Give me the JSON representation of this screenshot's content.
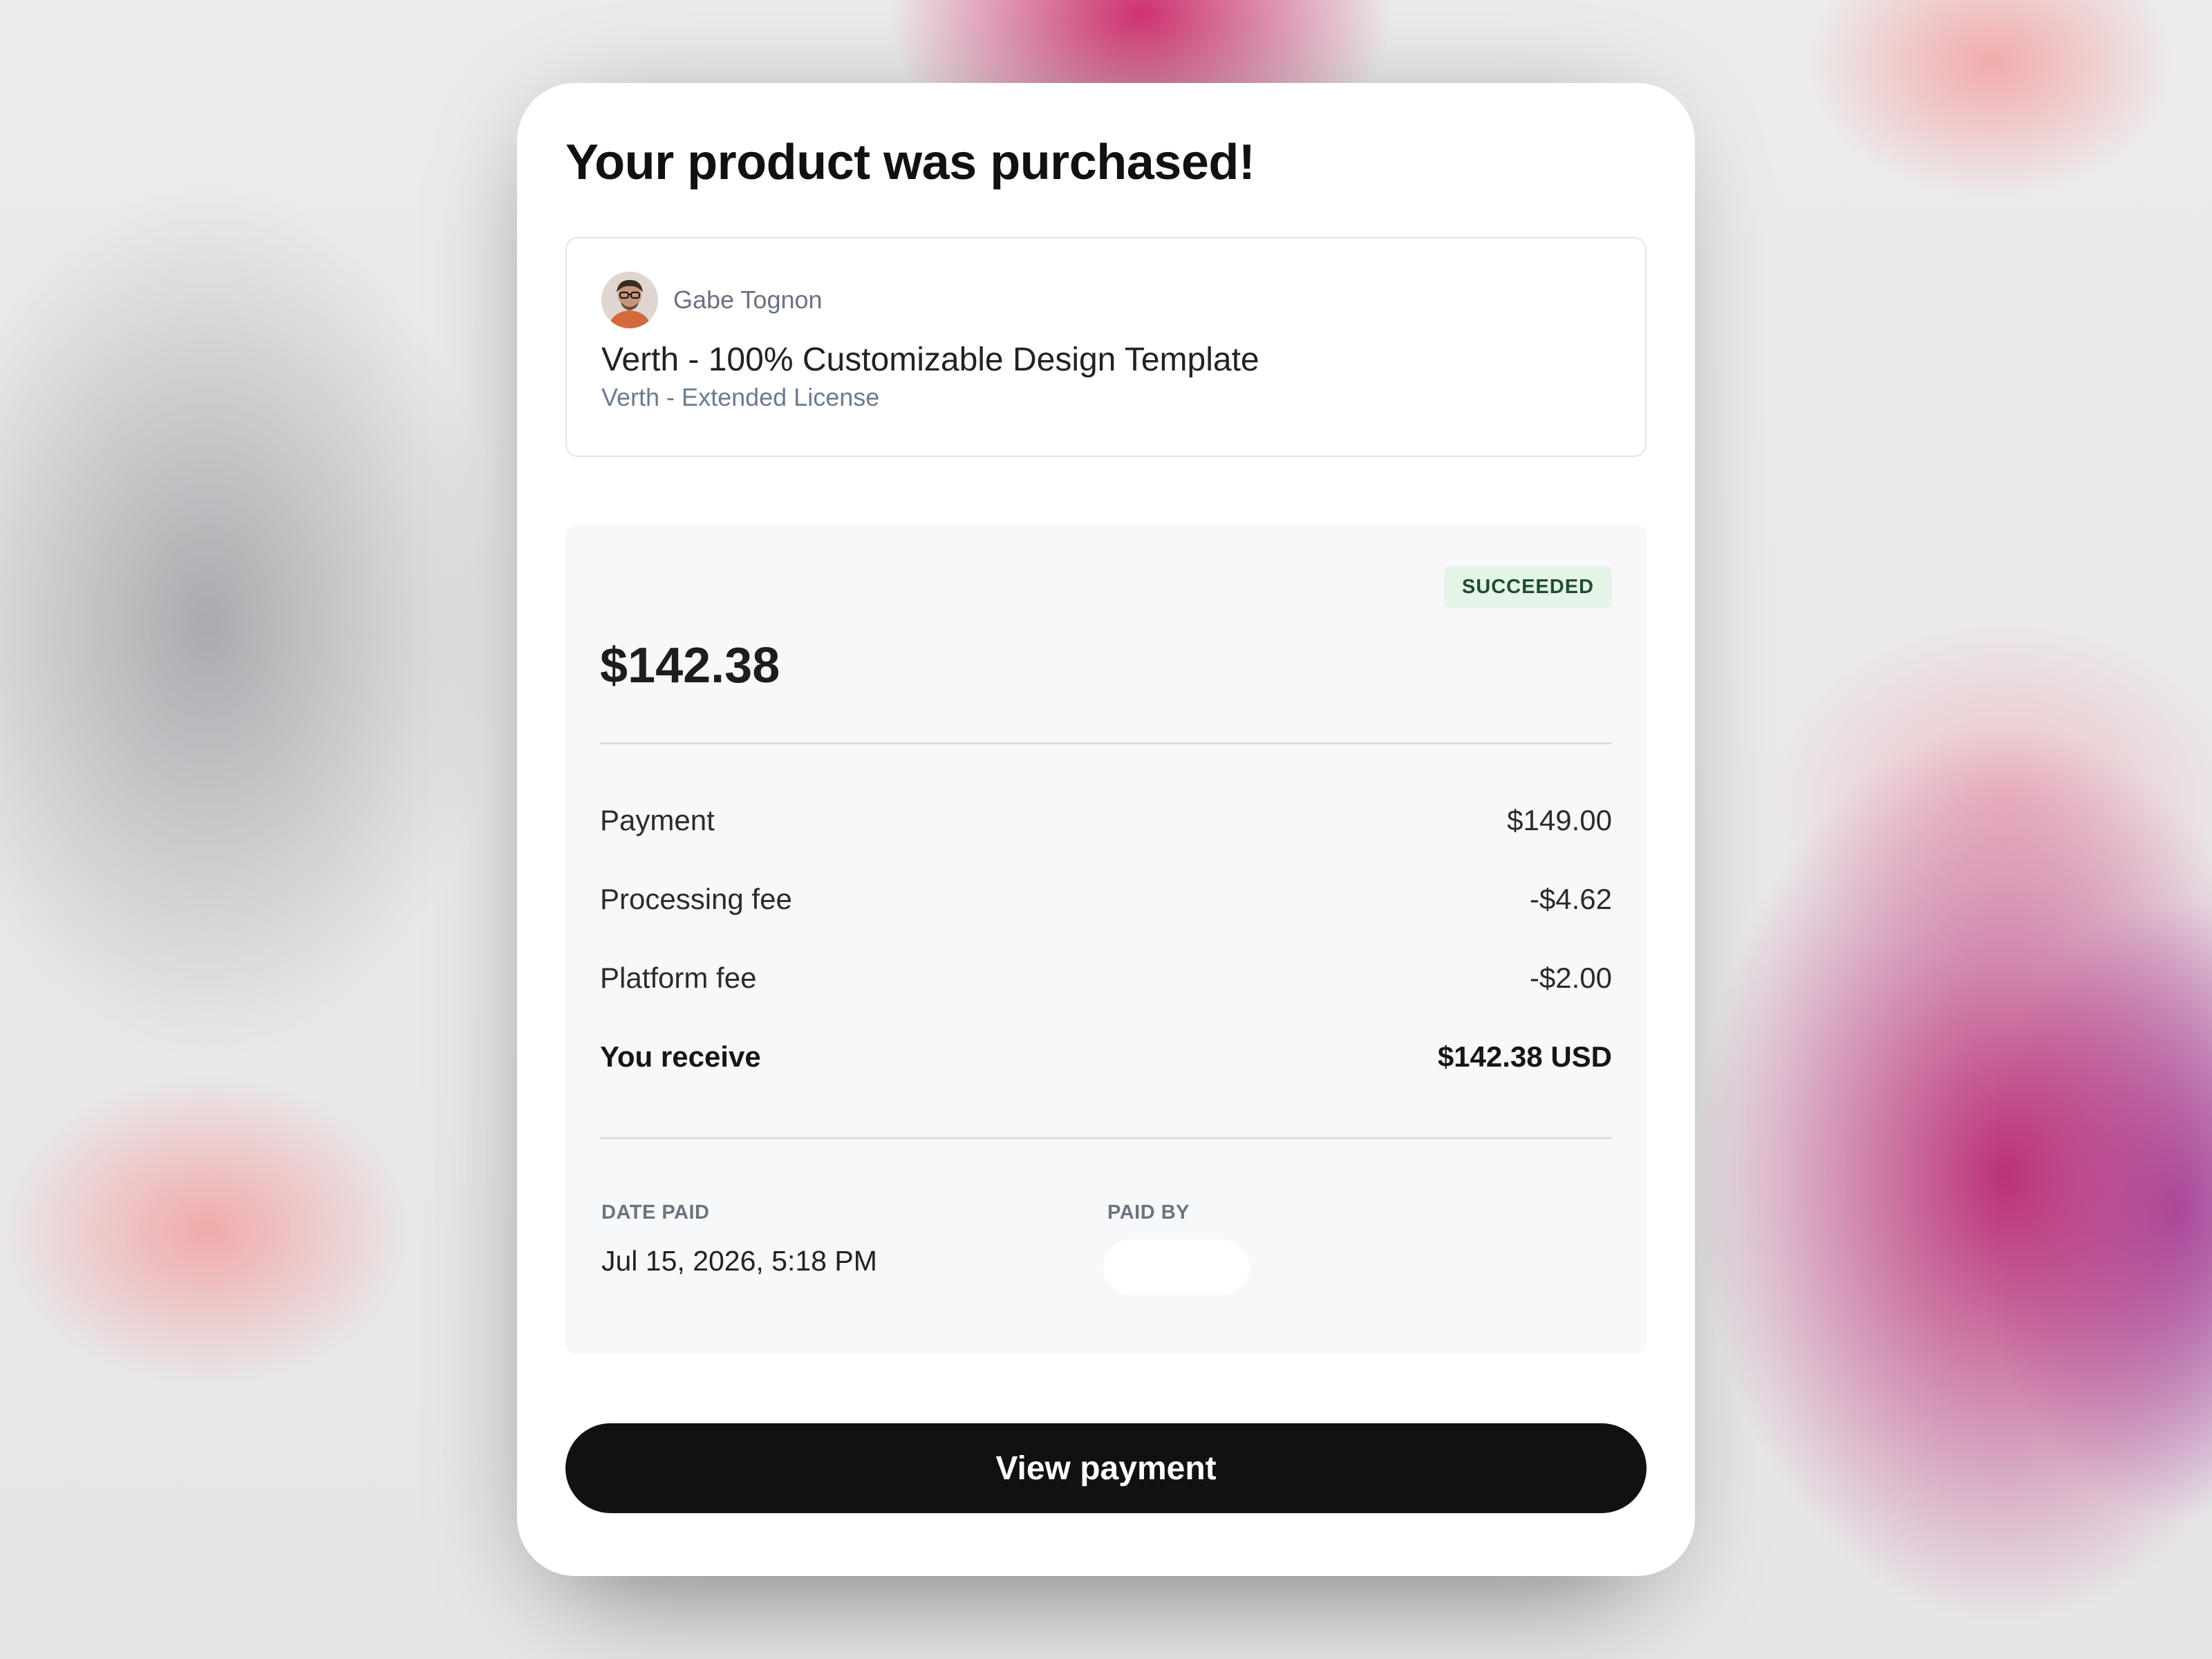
{
  "header": {
    "title": "Your product was purchased!"
  },
  "product": {
    "author_name": "Gabe Tognon",
    "avatar_icon": "user-avatar-icon",
    "name": "Verth - 100% Customizable Design Template",
    "license": "Verth - Extended License"
  },
  "payment": {
    "status": "SUCCEEDED",
    "status_color": "#e5f4e8",
    "amount": "$142.38",
    "items": [
      {
        "label": "Payment",
        "value": "$149.00"
      },
      {
        "label": "Processing fee",
        "value": "-$4.62"
      },
      {
        "label": "Platform fee",
        "value": "-$2.00"
      }
    ],
    "total": {
      "label": "You receive",
      "value": "$142.38 USD"
    },
    "date_paid": {
      "label": "DATE PAID",
      "value": "Jul 15, 2026, 5:18 PM"
    },
    "paid_by": {
      "label": "PAID BY"
    }
  },
  "actions": {
    "view_payment_label": "View payment"
  },
  "colors": {
    "button": "#111111",
    "background_accent_pink": "#cd2869",
    "background_accent_purple": "#9646aa"
  }
}
